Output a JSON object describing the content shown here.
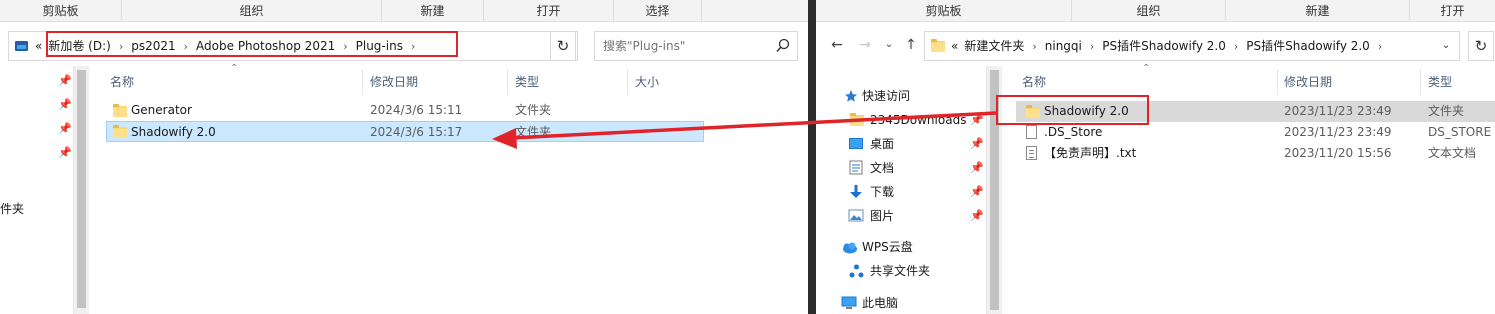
{
  "left": {
    "ribbon": [
      "剪贴板",
      "组织",
      "新建",
      "打开",
      "选择"
    ],
    "breadcrumb_prefix": "«",
    "breadcrumb": [
      "新加卷 (D:)",
      "ps2021",
      "Adobe Photoshop 2021",
      "Plug-ins"
    ],
    "search_placeholder": "搜索\"Plug-ins\"",
    "columns": [
      "名称",
      "修改日期",
      "类型",
      "大小"
    ],
    "rows": [
      {
        "name": "Generator",
        "date": "2024/3/6 15:11",
        "type": "文件夹",
        "selected": false
      },
      {
        "name": "Shadowify 2.0",
        "date": "2024/3/6 15:17",
        "type": "文件夹",
        "selected": true
      }
    ],
    "cut_label": "件夹"
  },
  "right": {
    "ribbon": [
      "剪贴板",
      "组织",
      "新建",
      "打开"
    ],
    "breadcrumb_prefix": "«",
    "breadcrumb": [
      "新建文件夹",
      "ningqi",
      "PS插件Shadowify 2.0",
      "PS插件Shadowify 2.0"
    ],
    "nav": [
      {
        "label": "快速访问",
        "icon": "star-icon"
      },
      {
        "label": "2345Downloads",
        "icon": "folder-icon",
        "pinned": true
      },
      {
        "label": "桌面",
        "icon": "desktop-icon",
        "pinned": true
      },
      {
        "label": "文档",
        "icon": "document-icon",
        "pinned": true
      },
      {
        "label": "下载",
        "icon": "download-icon",
        "pinned": true
      },
      {
        "label": "图片",
        "icon": "picture-icon",
        "pinned": true
      },
      {
        "label": "WPS云盘",
        "icon": "cloud-icon"
      },
      {
        "label": "共享文件夹",
        "icon": "share-icon"
      },
      {
        "label": "此电脑",
        "icon": "computer-icon"
      }
    ],
    "columns": [
      "名称",
      "修改日期",
      "类型"
    ],
    "rows": [
      {
        "name": "Shadowify 2.0",
        "date": "2023/11/23 23:49",
        "type": "文件夹",
        "icon": "folder-icon"
      },
      {
        "name": ".DS_Store",
        "date": "2023/11/23 23:49",
        "type": "DS_STORE 文",
        "icon": "file-icon"
      },
      {
        "name": "【免责声明】.txt",
        "date": "2023/11/20 15:56",
        "type": "文本文档",
        "icon": "text-file-icon"
      }
    ]
  },
  "colors": {
    "highlight": "#e0242a",
    "selection": "#cce8ff",
    "folder": "#ffe08a"
  }
}
